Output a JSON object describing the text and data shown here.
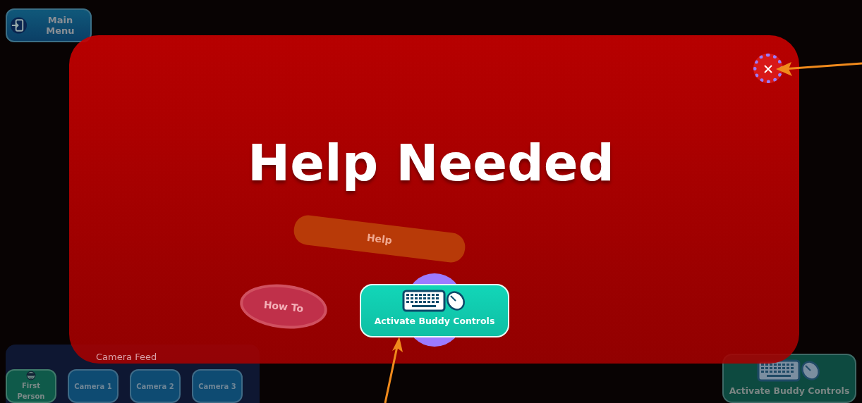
{
  "hud": {
    "main_menu": "Main Menu",
    "camera_feed": {
      "title": "Camera Feed",
      "buttons": [
        {
          "label": "First Person",
          "kind": "icon",
          "selected": true
        },
        {
          "label": "Camera 1",
          "kind": "text",
          "selected": false
        },
        {
          "label": "Camera 2",
          "kind": "text",
          "selected": false
        },
        {
          "label": "Camera 3",
          "kind": "text",
          "selected": false
        }
      ]
    },
    "buddy_button": "Activate Buddy Controls"
  },
  "scene": {
    "labels": [
      {
        "text": "Help",
        "kind": "banner"
      },
      {
        "text": "How To",
        "kind": "oval"
      }
    ]
  },
  "dialog": {
    "title": "Help Needed",
    "button": "Activate Buddy Controls"
  }
}
